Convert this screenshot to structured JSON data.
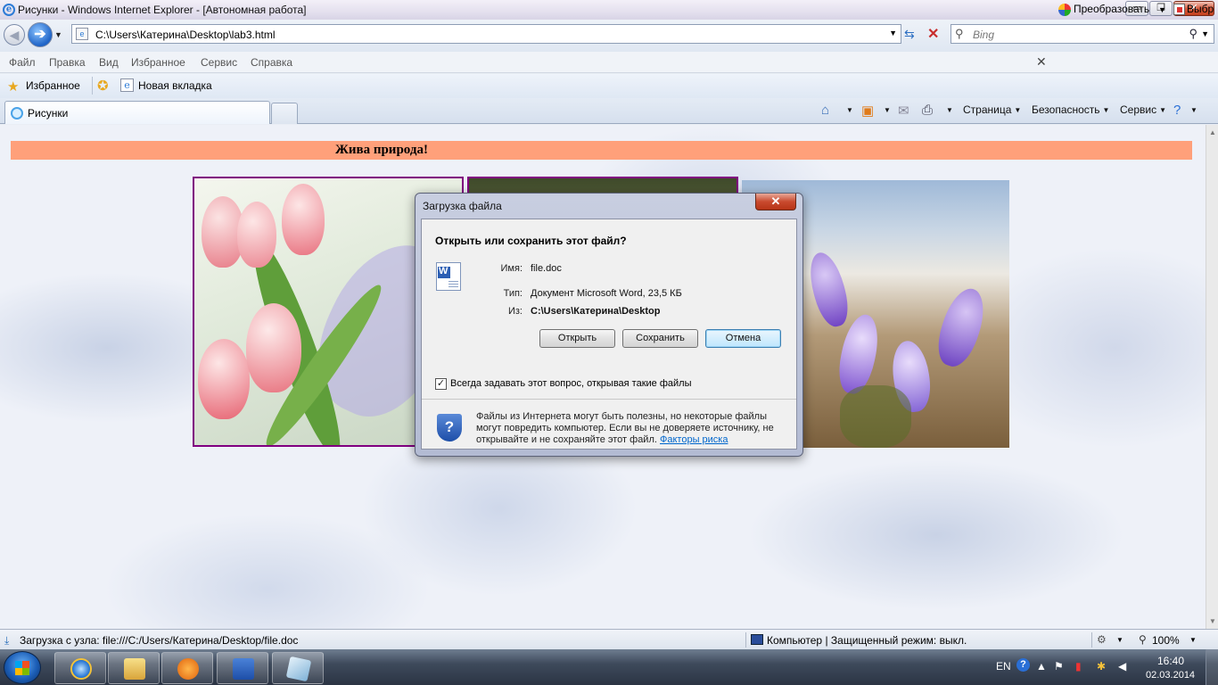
{
  "window": {
    "title": "Рисунки - Windows Internet Explorer - [Автономная работа]",
    "controls": {
      "minimize": "▭",
      "maximize": "❐",
      "close": "✕"
    }
  },
  "address_bar": {
    "url": "C:\\Users\\Катерина\\Desktop\\lab3.html"
  },
  "search": {
    "placeholder": "Bing"
  },
  "menu": {
    "items": [
      "Файл",
      "Правка",
      "Вид",
      "Избранное",
      "Сервис",
      "Справка"
    ]
  },
  "addon_toolbar": {
    "convert_label": "Преобразовать",
    "select_label": "Выбр"
  },
  "favorites_bar": {
    "favorites_label": "Избранное",
    "new_tab_label": "Новая вкладка"
  },
  "tab": {
    "label": "Рисунки"
  },
  "command_bar": {
    "page": "Страница",
    "safety": "Безопасность",
    "tools": "Сервис"
  },
  "page": {
    "banner": "Жива природа!",
    "banner_color": "#ffa07a",
    "images": [
      "tulips",
      "landscape",
      "crocuses"
    ]
  },
  "dialog": {
    "title": "Загрузка файла",
    "question": "Открыть или сохранить этот файл?",
    "name_label": "Имя:",
    "name_value": "file.doc",
    "type_label": "Тип:",
    "type_value": "Документ Microsoft Word, 23,5 КБ",
    "from_label": "Из:",
    "from_value": "C:\\Users\\Катерина\\Desktop",
    "open_button": "Открыть",
    "save_button": "Сохранить",
    "cancel_button": "Отмена",
    "always_ask_checked": true,
    "always_ask_label": "Всегда задавать этот вопрос, открывая такие файлы",
    "warning_text": "Файлы из Интернета могут быть полезны, но некоторые файлы могут повредить компьютер. Если вы не доверяете источнику, не открывайте и не сохраняйте этот файл.",
    "risk_link": "Факторы риска"
  },
  "status_bar": {
    "status": "Загрузка с узла: file:///C:/Users/Катерина/Desktop/file.doc",
    "zone": "Компьютер | Защищенный режим: выкл.",
    "zoom": "100%"
  },
  "taskbar": {
    "pinned": [
      "internet-explorer",
      "windows-explorer",
      "media-player",
      "microsoft-word",
      "application"
    ],
    "language": "EN",
    "time": "16:40",
    "date": "02.03.2014"
  },
  "colors": {
    "accent": "#2d7bd6",
    "photo_border": "#800080",
    "link": "#0066cc"
  }
}
